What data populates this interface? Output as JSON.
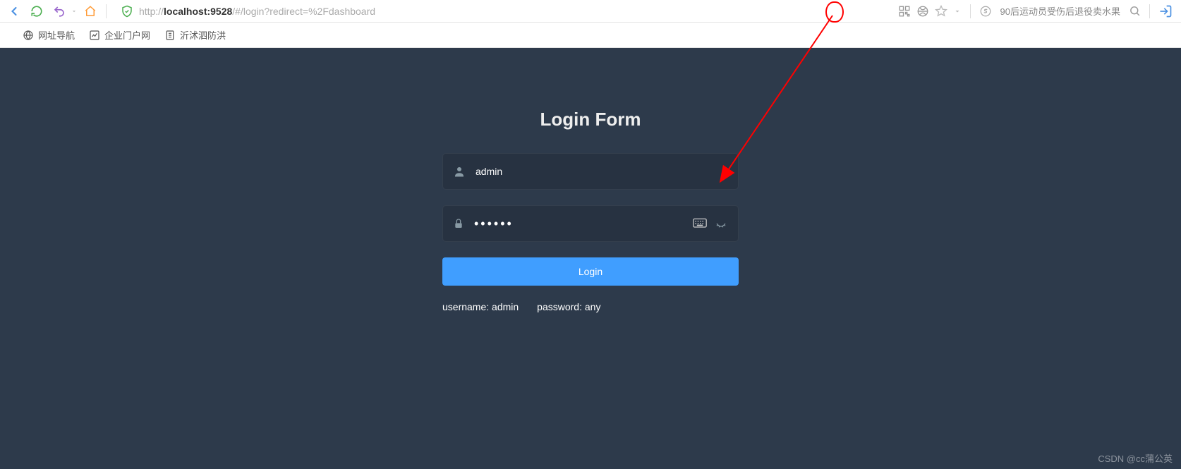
{
  "browser": {
    "url_prefix": "http://",
    "url_host": "localhost:9528",
    "url_path": "/#/login?redirect=%2Fdashboard",
    "hot_search_text": "90后运动员受伤后退役卖水果"
  },
  "bookmarks": [
    {
      "label": "网址导航"
    },
    {
      "label": "企业门户网"
    },
    {
      "label": "沂沭泗防洪"
    }
  ],
  "login": {
    "title": "Login Form",
    "username_value": "admin",
    "password_masked": "••••••",
    "login_button": "Login",
    "hint_username": "username: admin",
    "hint_password": "password: any"
  },
  "watermark": "CSDN @cc蒲公英"
}
